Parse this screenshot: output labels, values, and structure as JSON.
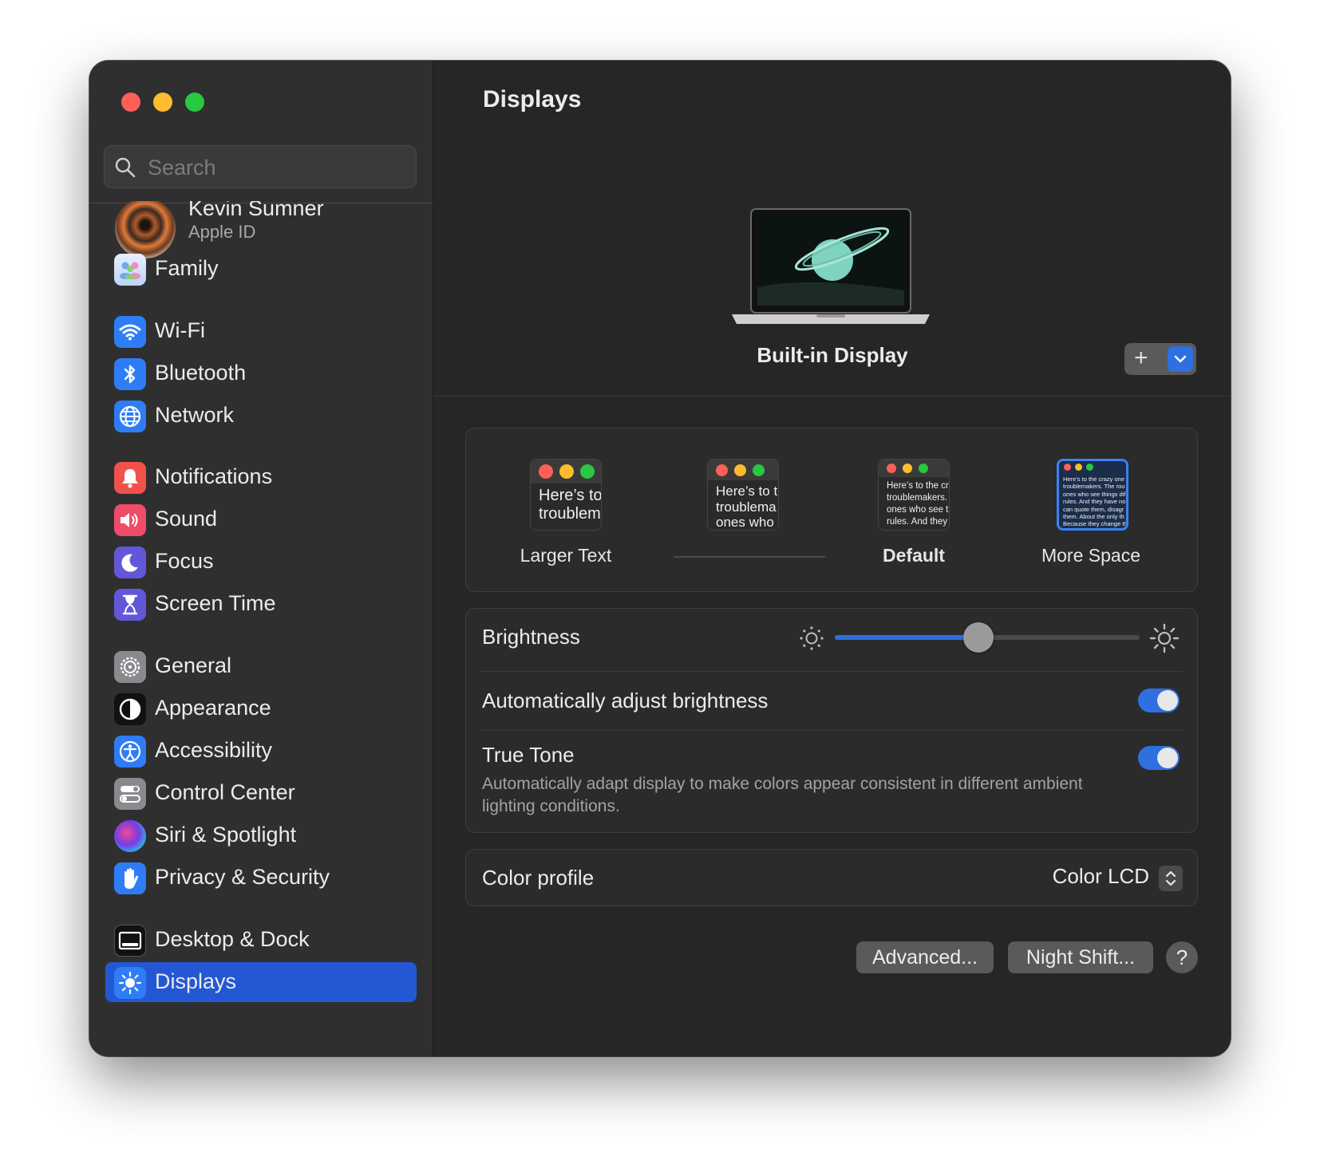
{
  "sidebar": {
    "search_placeholder": "Search",
    "profile": {
      "name": "Kevin Sumner",
      "subtitle": "Apple ID"
    },
    "items": [
      {
        "label": "Family",
        "icon": "family-icon"
      },
      {
        "label": "Wi-Fi",
        "icon": "wifi-icon"
      },
      {
        "label": "Bluetooth",
        "icon": "bluetooth-icon"
      },
      {
        "label": "Network",
        "icon": "globe-icon"
      },
      {
        "label": "Notifications",
        "icon": "bell-icon"
      },
      {
        "label": "Sound",
        "icon": "speaker-icon"
      },
      {
        "label": "Focus",
        "icon": "moon-icon"
      },
      {
        "label": "Screen Time",
        "icon": "hourglass-icon"
      },
      {
        "label": "General",
        "icon": "gear-icon"
      },
      {
        "label": "Appearance",
        "icon": "appearance-icon"
      },
      {
        "label": "Accessibility",
        "icon": "accessibility-icon"
      },
      {
        "label": "Control Center",
        "icon": "toggles-icon"
      },
      {
        "label": "Siri & Spotlight",
        "icon": "siri-icon"
      },
      {
        "label": "Privacy & Security",
        "icon": "hand-icon"
      },
      {
        "label": "Desktop & Dock",
        "icon": "dock-icon"
      },
      {
        "label": "Displays",
        "icon": "sun-icon",
        "active": true
      }
    ]
  },
  "main": {
    "title": "Displays",
    "display_name": "Built-in Display",
    "add_label": "+",
    "resolution": {
      "options": [
        {
          "label": "Larger Text",
          "preview": "Here’s to\ntroublem"
        },
        {
          "label": "",
          "preview": "Here’s to t\ntroublema\nones who"
        },
        {
          "label": "Default",
          "preview": "Here’s to the cr\ntroublemakers.\nones who see t\nrules. And they"
        },
        {
          "label": "More Space",
          "preview": "Here’s to the crazy one\ntroublemakers. The rou\nones who see things dif\nrules. And they have no\ncan quote them, disagr\nthem. About the only th\nBecause they change th"
        }
      ],
      "selected": "More Space"
    },
    "brightness": {
      "label": "Brightness",
      "value": 0.47
    },
    "auto_brightness": {
      "label": "Automatically adjust brightness",
      "on": true
    },
    "true_tone": {
      "label": "True Tone",
      "description": "Automatically adapt display to make colors appear consistent in different ambient lighting conditions.",
      "on": true
    },
    "color_profile": {
      "label": "Color profile",
      "value": "Color LCD"
    },
    "buttons": {
      "advanced": "Advanced...",
      "night_shift": "Night Shift...",
      "help": "?"
    }
  },
  "colors": {
    "accent": "#2f6fe0",
    "sidebar_active": "#2457d4",
    "traffic_red": "#fe5f57",
    "traffic_yellow": "#febc2e",
    "traffic_green": "#28c840"
  }
}
